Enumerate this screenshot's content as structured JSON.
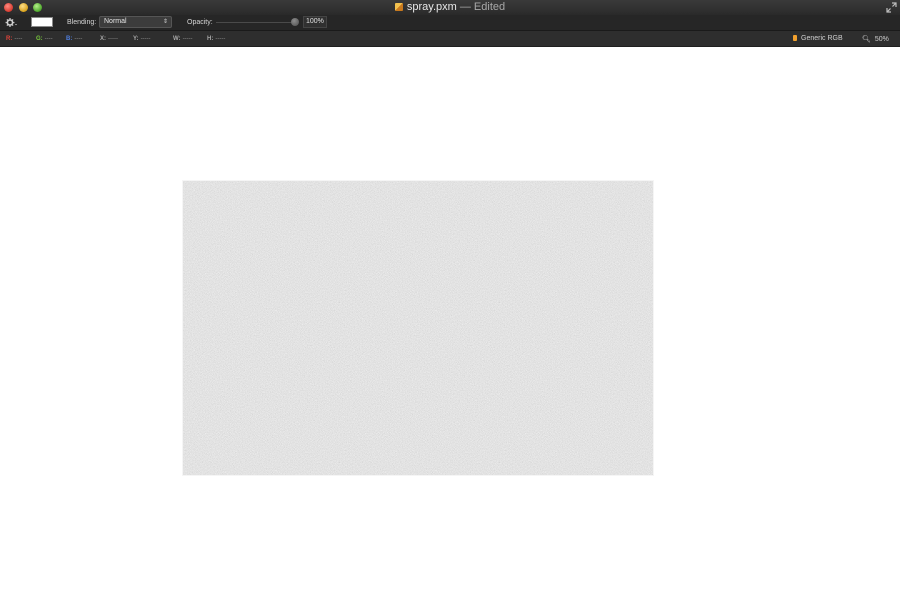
{
  "window": {
    "title": "spray.pxm",
    "title_suffix": "— Edited"
  },
  "icons": {
    "close": "close-traffic-light",
    "minimize": "minimize-traffic-light",
    "zoom": "zoom-traffic-light",
    "document": "pixelmator-document-icon",
    "fullscreen": "fullscreen-arrows-icon",
    "tool_options": "gear-icon",
    "color_profile": "color-profile-icon",
    "magnifier": "magnifier-icon"
  },
  "toolbar": {
    "blending_label": "Blending:",
    "blending_value": "Normal",
    "opacity_label": "Opacity:",
    "opacity_value": "100%",
    "opacity_fraction": 1.0,
    "color_well": "#ffffff"
  },
  "infobar": {
    "channels": [
      {
        "key": "R:",
        "value": "----",
        "color": "#e0443a"
      },
      {
        "key": "G:",
        "value": "----",
        "color": "#78c83c"
      },
      {
        "key": "B:",
        "value": "----",
        "color": "#4f7fe0"
      },
      {
        "key": "X:",
        "value": "-----",
        "color": "#a8a8a8"
      },
      {
        "key": "Y:",
        "value": "-----",
        "color": "#a8a8a8"
      },
      {
        "key": "W:",
        "value": "-----",
        "color": "#a8a8a8"
      },
      {
        "key": "H:",
        "value": "-----",
        "color": "#a8a8a8"
      }
    ],
    "color_profile": "Generic RGB",
    "zoom": "50%"
  },
  "canvas": {
    "fill": "#b9b9b9"
  }
}
